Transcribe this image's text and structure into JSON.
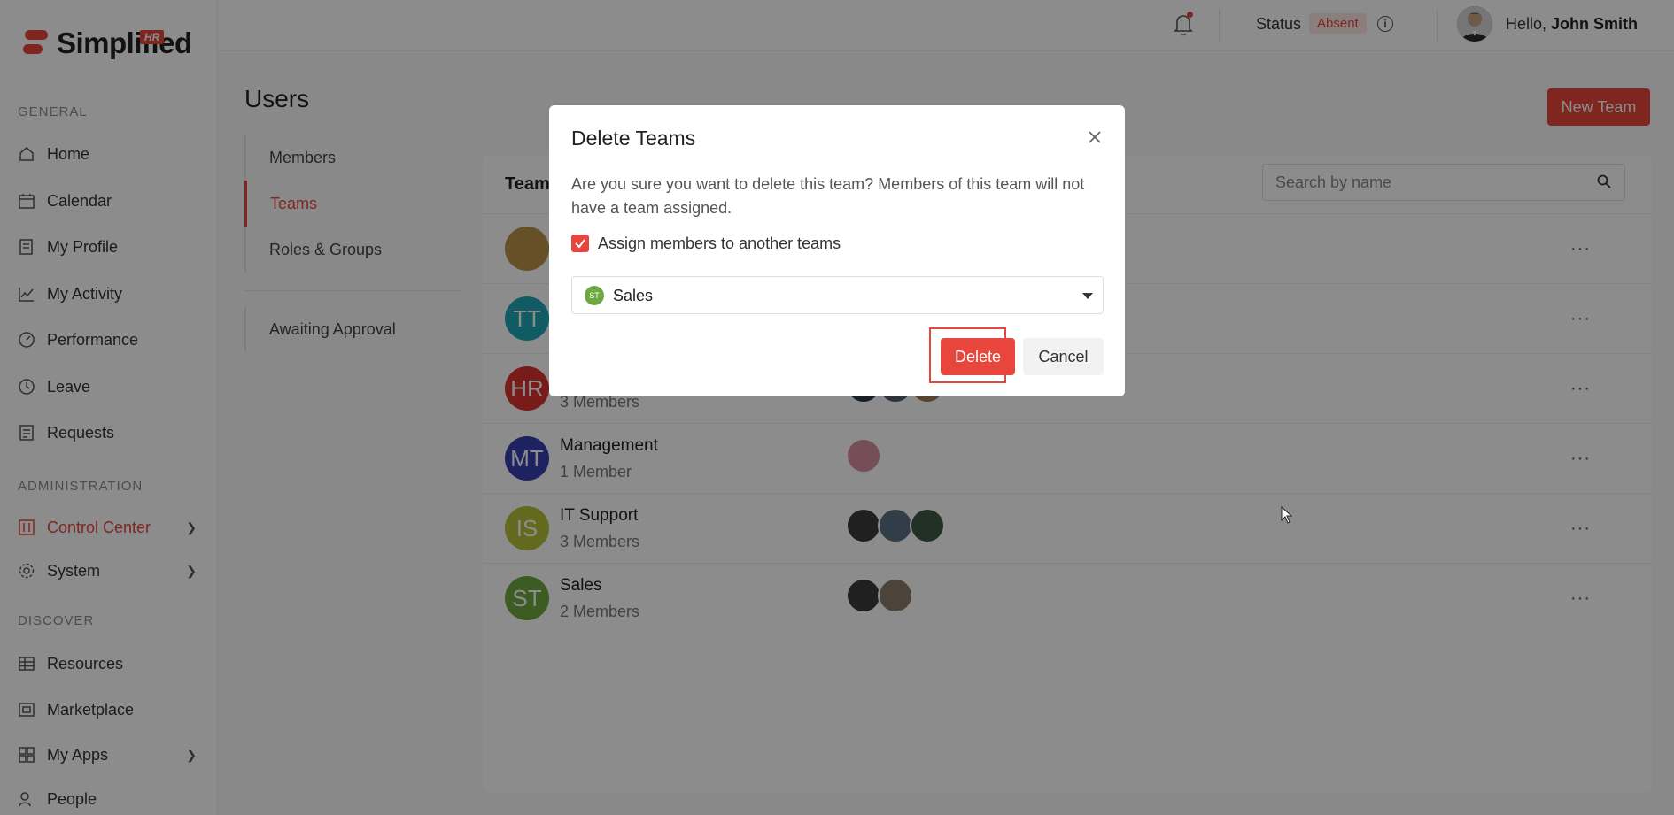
{
  "app": {
    "brand": "Simplified",
    "brand_badge": "HR"
  },
  "sidebar": {
    "sections": [
      {
        "label": "GENERAL"
      },
      {
        "label": "ADMINISTRATION"
      },
      {
        "label": "DISCOVER"
      }
    ],
    "items": [
      {
        "label": "Home",
        "icon": "home-icon"
      },
      {
        "label": "Calendar",
        "icon": "calendar-icon"
      },
      {
        "label": "My Profile",
        "icon": "profile-icon"
      },
      {
        "label": "My Activity",
        "icon": "activity-icon"
      },
      {
        "label": "Performance",
        "icon": "gauge-icon"
      },
      {
        "label": "Leave",
        "icon": "clock-icon"
      },
      {
        "label": "Requests",
        "icon": "requests-icon"
      },
      {
        "label": "Control Center",
        "icon": "control-icon",
        "active": true
      },
      {
        "label": "System",
        "icon": "gear-icon"
      },
      {
        "label": "Resources",
        "icon": "table-icon"
      },
      {
        "label": "Marketplace",
        "icon": "marketplace-icon"
      },
      {
        "label": "My Apps",
        "icon": "apps-icon"
      },
      {
        "label": "People",
        "icon": "people-icon"
      }
    ]
  },
  "topbar": {
    "status_label": "Status",
    "status_value": "Absent",
    "greeting": "Hello,",
    "user_name": "John Smith"
  },
  "page": {
    "title": "Users",
    "new_team_label": "New Team",
    "subnav": [
      "Members",
      "Teams",
      "Roles & Groups",
      "Awaiting Approval"
    ],
    "panel_title": "Teams",
    "search_placeholder": "Search by name"
  },
  "teams": [
    {
      "initials": "",
      "name": "",
      "count": "",
      "color": "#b8934a"
    },
    {
      "initials": "TT",
      "name": "",
      "count": "",
      "color": "#1fa6b8"
    },
    {
      "initials": "HR",
      "name": "",
      "count": "3 Members",
      "color": "#d9332c"
    },
    {
      "initials": "MT",
      "name": "Management",
      "count": "1 Member",
      "color": "#3a3fb0"
    },
    {
      "initials": "IS",
      "name": "IT Support",
      "count": "3 Members",
      "color": "#b5c13a"
    },
    {
      "initials": "ST",
      "name": "Sales",
      "count": "2 Members",
      "color": "#6ea842"
    }
  ],
  "modal": {
    "title": "Delete Teams",
    "message": "Are you sure you want to delete this team? Members of this team will not have a team assigned.",
    "checkbox_label": "Assign members to another teams",
    "checkbox_checked": true,
    "select_initials": "ST",
    "select_value": "Sales",
    "delete_label": "Delete",
    "cancel_label": "Cancel"
  },
  "colors": {
    "accent": "#e8453c"
  }
}
